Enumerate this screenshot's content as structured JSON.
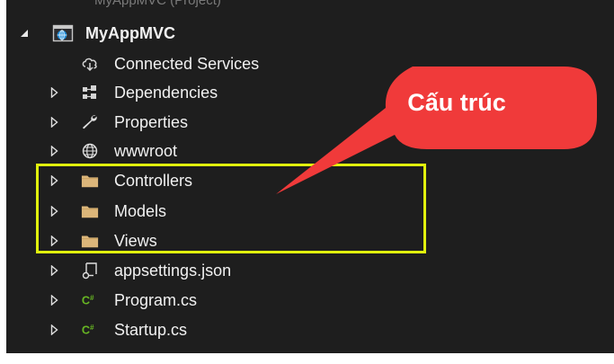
{
  "cut_header": "MyAppMVC (Project)",
  "tree": {
    "root": {
      "label": "MyAppMVC",
      "icon": "web-project-icon",
      "expanded": true
    },
    "items": [
      {
        "label": "Connected Services",
        "icon": "connected-services-icon",
        "has_expander": false
      },
      {
        "label": "Dependencies",
        "icon": "dependencies-icon",
        "has_expander": true
      },
      {
        "label": "Properties",
        "icon": "wrench-icon",
        "has_expander": true
      },
      {
        "label": "wwwroot",
        "icon": "globe-icon",
        "has_expander": true
      },
      {
        "label": "Controllers",
        "icon": "folder-icon",
        "has_expander": true
      },
      {
        "label": "Models",
        "icon": "folder-icon",
        "has_expander": true
      },
      {
        "label": "Views",
        "icon": "folder-icon",
        "has_expander": true
      },
      {
        "label": "appsettings.json",
        "icon": "json-file-icon",
        "has_expander": true
      },
      {
        "label": "Program.cs",
        "icon": "csharp-file-icon",
        "has_expander": true
      },
      {
        "label": "Startup.cs",
        "icon": "csharp-file-icon",
        "has_expander": true
      }
    ]
  },
  "callout": {
    "text": "Cấu trúc"
  },
  "colors": {
    "background": "#1e1e1e",
    "text": "#f1f1f1",
    "folder": "#dcb67a",
    "csharp": "#68b723",
    "highlight": "#e1f20d",
    "callout": "#f03a3a"
  }
}
